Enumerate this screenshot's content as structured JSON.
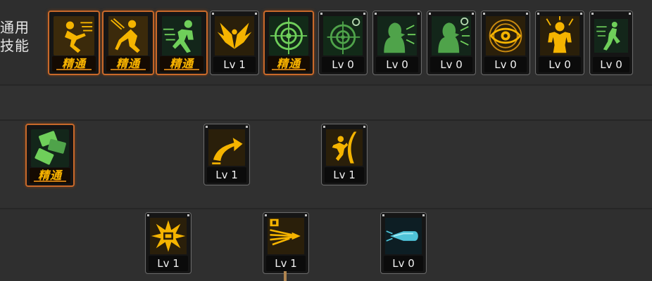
{
  "section": {
    "title_line1": "通用",
    "title_line2": "技能"
  },
  "colors": {
    "gold": "#f5b400",
    "green": "#6fcf5a",
    "cyan": "#4fc3d8",
    "master_border": "#c9692a"
  },
  "skills": {
    "row1": [
      {
        "name": "sprint",
        "icon": "runner-icon",
        "level": "精通",
        "theme": "gold",
        "master": true
      },
      {
        "name": "crouch",
        "icon": "kneel-icon",
        "level": "精通",
        "theme": "gold",
        "master": true
      },
      {
        "name": "dodge",
        "icon": "dash-icon",
        "level": "精通",
        "theme": "green",
        "master": true
      },
      {
        "name": "eagle",
        "icon": "wings-icon",
        "level": "Lv 1",
        "theme": "gold",
        "master": false
      },
      {
        "name": "precision",
        "icon": "crosshair-icon",
        "level": "精通",
        "theme": "green",
        "master": true
      },
      {
        "name": "precision-advanced",
        "icon": "crosshair-gear-icon",
        "level": "Lv 0",
        "theme": "green",
        "master": false
      },
      {
        "name": "shout",
        "icon": "shout-icon",
        "level": "Lv 0",
        "theme": "green",
        "master": false
      },
      {
        "name": "shout-advanced",
        "icon": "shout-gear-icon",
        "level": "Lv 0",
        "theme": "green",
        "master": false
      },
      {
        "name": "eye",
        "icon": "eye-icon",
        "level": "Lv 0",
        "theme": "gold",
        "master": false
      },
      {
        "name": "power",
        "icon": "strongman-icon",
        "level": "Lv 0",
        "theme": "gold",
        "master": false
      },
      {
        "name": "kick",
        "icon": "kick-icon",
        "level": "Lv 0",
        "theme": "green",
        "master": false
      }
    ],
    "row2": [
      {
        "name": "cards",
        "icon": "cards-icon",
        "level": "精通",
        "theme": "green",
        "master": true
      },
      {
        "name": "arrow-up",
        "icon": "curved-arrow-icon",
        "level": "Lv 1",
        "theme": "gold",
        "master": false
      },
      {
        "name": "slash",
        "icon": "slash-fighter-icon",
        "level": "Lv 1",
        "theme": "gold",
        "master": false
      }
    ],
    "row3": [
      {
        "name": "burst",
        "icon": "explosion-icon",
        "level": "Lv 1",
        "theme": "gold",
        "master": false
      },
      {
        "name": "shot",
        "icon": "bullet-s-icon",
        "level": "Lv 1",
        "theme": "gold",
        "master": false
      },
      {
        "name": "round",
        "icon": "blue-round-icon",
        "level": "Lv 0",
        "theme": "cyan",
        "master": false
      }
    ]
  }
}
